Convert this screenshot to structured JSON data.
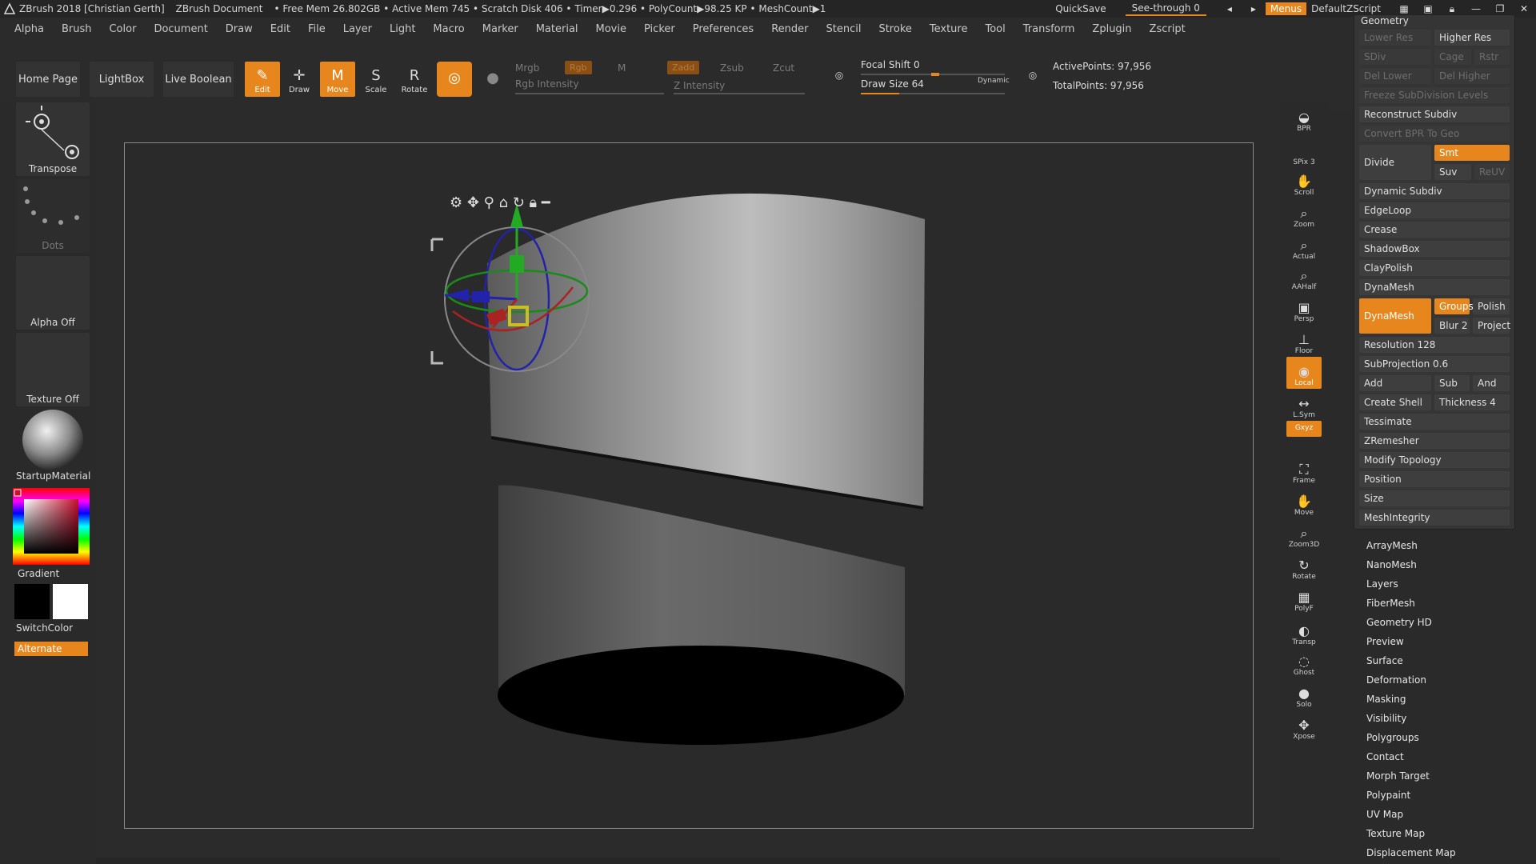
{
  "titlebar": {
    "app": "ZBrush 2018 [Christian Gerth]",
    "doc": "ZBrush Document",
    "stats": "• Free Mem 26.802GB • Active Mem 745 • Scratch Disk 406 • Timer▶0.296 • PolyCount▶98.25 KP • MeshCount▶1",
    "quicksave": "QuickSave",
    "seethrough": "See-through  0",
    "menus": "Menus",
    "script": "DefaultZScript"
  },
  "menubar": [
    "Alpha",
    "Brush",
    "Color",
    "Document",
    "Draw",
    "Edit",
    "File",
    "Layer",
    "Light",
    "Macro",
    "Marker",
    "Material",
    "Movie",
    "Picker",
    "Preferences",
    "Render",
    "Stencil",
    "Stroke",
    "Texture",
    "Tool",
    "Transform",
    "Zplugin",
    "Zscript"
  ],
  "toolbar": {
    "home": "Home Page",
    "lightbox": "LightBox",
    "liveboolean": "Live Boolean",
    "modes": {
      "edit": "Edit",
      "draw": "Draw",
      "move": "Move",
      "scale": "Scale",
      "rotate": "Rotate"
    },
    "mrgb": "Mrgb",
    "rgb": "Rgb",
    "m": "M",
    "rgb_intensity": "Rgb Intensity",
    "zadd": "Zadd",
    "zsub": "Zsub",
    "zcut": "Zcut",
    "z_intensity": "Z Intensity",
    "focal_shift": "Focal Shift 0",
    "draw_size": "Draw Size 64",
    "dynamic": "Dynamic",
    "active_points": "ActivePoints: 97,956",
    "total_points": "TotalPoints: 97,956"
  },
  "leftshelf": {
    "transpose": "Transpose",
    "dots": "Dots",
    "alpha": "Alpha Off",
    "texture": "Texture Off",
    "material": "StartupMaterial",
    "gradient": "Gradient",
    "switchcolor": "SwitchColor",
    "alternate": "Alternate"
  },
  "rightshelf": [
    "BPR",
    "SPix 3",
    "Scroll",
    "Zoom",
    "Actual",
    "AAHalf",
    "Persp",
    "Floor",
    "Local",
    "L.Sym",
    "Gxyz",
    "Frame",
    "Move",
    "Zoom3D",
    "Rotate",
    "PolyF",
    "Transp",
    "Ghost",
    "Solo",
    "Xpose"
  ],
  "palette": {
    "title": "Geometry",
    "lower_res": "Lower Res",
    "higher_res": "Higher Res",
    "sdiv": "SDiv",
    "cage": "Cage",
    "rstr": "Rstr",
    "del_lower": "Del Lower",
    "del_higher": "Del Higher",
    "freeze": "Freeze SubDivision Levels",
    "reconstruct": "Reconstruct Subdiv",
    "convert_bpr": "Convert BPR To Geo",
    "divide": "Divide",
    "smt": "Smt",
    "suv": "Suv",
    "reuv": "ReUV",
    "dynamic_subdiv": "Dynamic Subdiv",
    "edgeloop": "EdgeLoop",
    "crease": "Crease",
    "shadowbox": "ShadowBox",
    "claypolish": "ClayPolish",
    "dynamesh_header": "DynaMesh",
    "dynamesh_btn": "DynaMesh",
    "groups": "Groups",
    "polish": "Polish",
    "blur": "Blur 2",
    "project": "Project",
    "resolution": "Resolution 128",
    "subprojection": "SubProjection 0.6",
    "add": "Add",
    "sub": "Sub",
    "and": "And",
    "create_shell": "Create Shell",
    "thickness": "Thickness 4",
    "tessimate": "Tessimate",
    "zremesher": "ZRemesher",
    "modify_topology": "Modify Topology",
    "position": "Position",
    "size": "Size",
    "meshintegrity": "MeshIntegrity"
  },
  "toollist": [
    "ArrayMesh",
    "NanoMesh",
    "Layers",
    "FiberMesh",
    "Geometry HD",
    "Preview",
    "Surface",
    "Deformation",
    "Masking",
    "Visibility",
    "Polygroups",
    "Contact",
    "Morph Target",
    "Polypaint",
    "UV Map",
    "Texture Map",
    "Displacement Map"
  ],
  "colors": {
    "accent": "#e8861e",
    "panel": "#353535",
    "bg": "#2a2a2a"
  }
}
